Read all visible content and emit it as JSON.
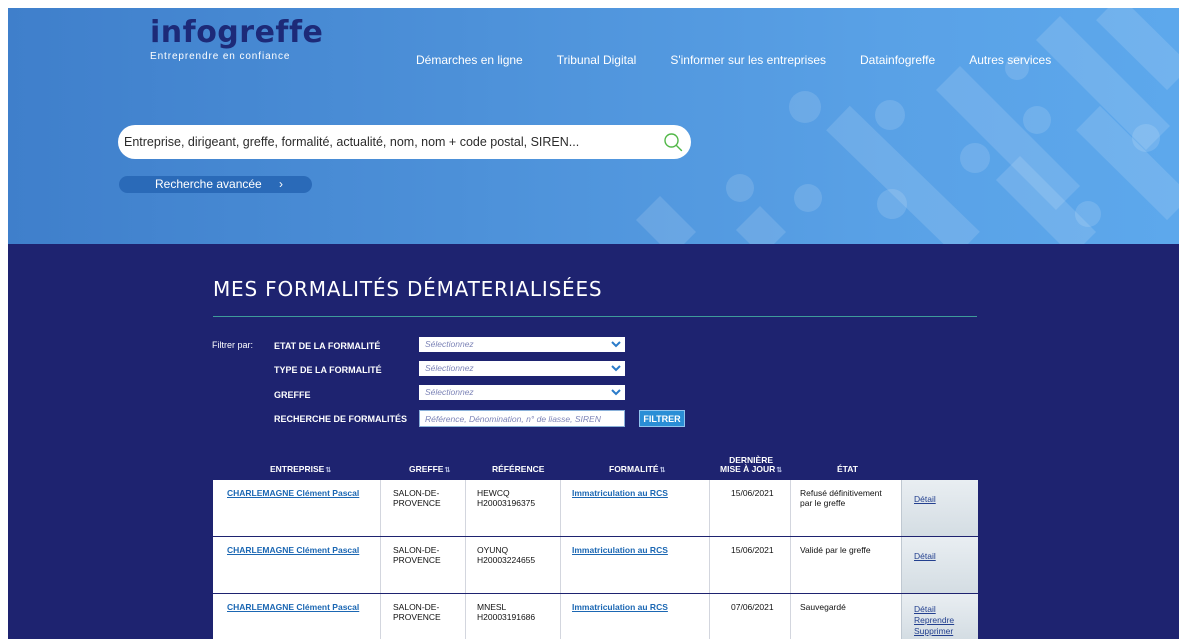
{
  "brand": {
    "name": "infogreffe",
    "tagline": "Entreprendre en confiance"
  },
  "nav": {
    "items": [
      "Démarches en ligne",
      "Tribunal Digital",
      "S'informer sur les entreprises",
      "Datainfogreffe",
      "Autres services"
    ]
  },
  "search": {
    "placeholder": "Entreprise, dirigeant, greffe, formalité, actualité, nom, nom + code postal, SIREN...",
    "advanced_label": "Recherche avancée",
    "advanced_chevron": "›"
  },
  "page": {
    "title": "MES FORMALITÉS DÉMATERIALISÉES"
  },
  "filters": {
    "caption": "Filtrer par:",
    "etat_label": "ETAT DE LA FORMALITÉ",
    "etat_value": "Sélectionnez",
    "type_label": "TYPE DE LA FORMALITÉ",
    "type_value": "Sélectionnez",
    "greffe_label": "GREFFE",
    "greffe_value": "Sélectionnez",
    "recherche_label": "RECHERCHE DE FORMALITÉS",
    "recherche_placeholder": "Référence, Dénomination, n° de liasse, SIREN",
    "button_label": "FILTRER"
  },
  "table": {
    "headers": {
      "entreprise": "ENTREPRISE",
      "greffe": "GREFFE",
      "reference": "RÉFÉRENCE",
      "formalite": "FORMALITÉ",
      "derniere_line1": "DERNIÈRE",
      "derniere_line2": "MISE À JOUR",
      "etat": "ÉTAT",
      "sort_glyph": "⇅"
    },
    "rows": [
      {
        "entreprise": "CHARLEMAGNE Clément Pascal",
        "greffe_line1": "SALON-DE-",
        "greffe_line2": "PROVENCE",
        "ref_line1": "HEWCQ",
        "ref_line2": "H20003196375",
        "formalite": "Immatriculation au RCS",
        "date": "15/06/2021",
        "etat_line1": "Refusé définitivement",
        "etat_line2": "par le greffe",
        "actions": [
          "Détail"
        ]
      },
      {
        "entreprise": "CHARLEMAGNE Clément Pascal",
        "greffe_line1": "SALON-DE-",
        "greffe_line2": "PROVENCE",
        "ref_line1": "OYUNQ",
        "ref_line2": "H20003224655",
        "formalite": "Immatriculation au RCS",
        "date": "15/06/2021",
        "etat_line1": "Validé par le greffe",
        "etat_line2": "",
        "actions": [
          "Détail"
        ]
      },
      {
        "entreprise": "CHARLEMAGNE Clément Pascal",
        "greffe_line1": "SALON-DE-",
        "greffe_line2": "PROVENCE",
        "ref_line1": "MNESL",
        "ref_line2": "H20003191686",
        "formalite": "Immatriculation au RCS",
        "date": "07/06/2021",
        "etat_line1": "Sauvegardé",
        "etat_line2": "",
        "actions": [
          "Détail",
          "Reprendre",
          "Supprimer"
        ]
      }
    ]
  },
  "colors": {
    "hero_blue": "#4d91d9",
    "navy": "#1e2370",
    "link_blue": "#1b67b3",
    "accent_teal": "#3f9b9a",
    "button_blue": "#2a8ed6"
  }
}
